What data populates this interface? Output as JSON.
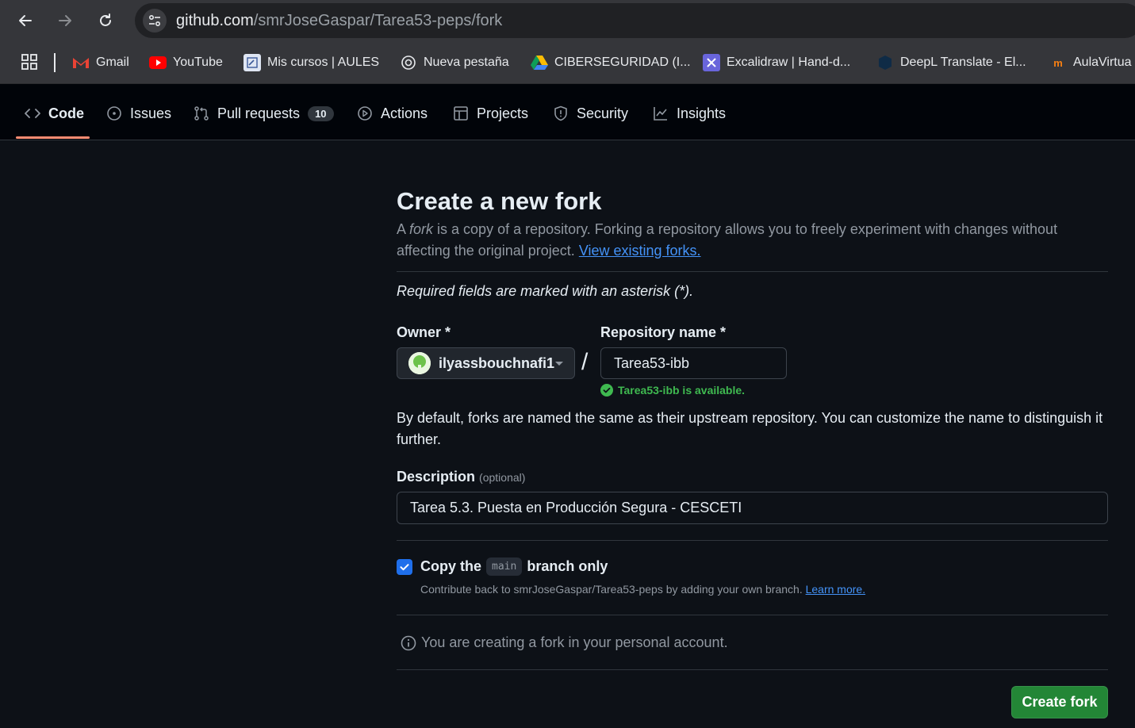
{
  "browser": {
    "url_host": "github.com",
    "url_path": "/smrJoseGaspar/Tarea53-peps/fork",
    "bookmarks": [
      {
        "label": "Gmail",
        "icon": "gmail-icon"
      },
      {
        "label": "YouTube",
        "icon": "youtube-icon"
      },
      {
        "label": "Mis cursos | AULES",
        "icon": "aules-icon"
      },
      {
        "label": "Nueva pestaña",
        "icon": "openai-icon"
      },
      {
        "label": "CIBERSEGURIDAD (I...",
        "icon": "google-drive-icon"
      },
      {
        "label": "Excalidraw | Hand-d...",
        "icon": "excalidraw-icon"
      },
      {
        "label": "DeepL Translate - El...",
        "icon": "deepl-icon"
      },
      {
        "label": "AulaVirtua",
        "icon": "aulavirtual-icon"
      }
    ]
  },
  "repo_nav": {
    "tabs": [
      {
        "label": "Code",
        "icon": "code-icon",
        "active": true
      },
      {
        "label": "Issues",
        "icon": "issue-opened-icon"
      },
      {
        "label": "Pull requests",
        "icon": "git-pull-request-icon",
        "counter": "10"
      },
      {
        "label": "Actions",
        "icon": "play-icon"
      },
      {
        "label": "Projects",
        "icon": "table-icon"
      },
      {
        "label": "Security",
        "icon": "shield-icon"
      },
      {
        "label": "Insights",
        "icon": "graph-icon"
      }
    ]
  },
  "form": {
    "title": "Create a new fork",
    "subtitle_prefix": "A ",
    "subtitle_em": "fork",
    "subtitle_rest": " is a copy of a repository. Forking a repository allows you to freely experiment with changes without affecting the original project. ",
    "view_forks_link": "View existing forks.",
    "required_note": "Required fields are marked with an asterisk (*).",
    "owner_label": "Owner *",
    "owner_value": "ilyassbouchnafi1",
    "slash": "/",
    "repo_label": "Repository name *",
    "repo_value": "Tarea53-ibb",
    "availability": "Tarea53-ibb is available.",
    "default_note": "By default, forks are named the same as their upstream repository. You can customize the name to distinguish it further.",
    "description_label": "Description",
    "description_optional": "(optional)",
    "description_value": "Tarea 5.3. Puesta en Producción Segura - CESCETI",
    "copy_prefix": "Copy the",
    "copy_branch": "main",
    "copy_suffix": "branch only",
    "copy_checked": true,
    "copy_note": "Contribute back to smrJoseGaspar/Tarea53-peps by adding your own branch. ",
    "learn_more": "Learn more.",
    "info_text": "You are creating a fork in your personal account.",
    "submit_label": "Create fork"
  },
  "colors": {
    "accent_link": "#4493f8",
    "success": "#3fb950",
    "primary_button": "#238636",
    "active_tab_underline": "#fd8c73"
  }
}
